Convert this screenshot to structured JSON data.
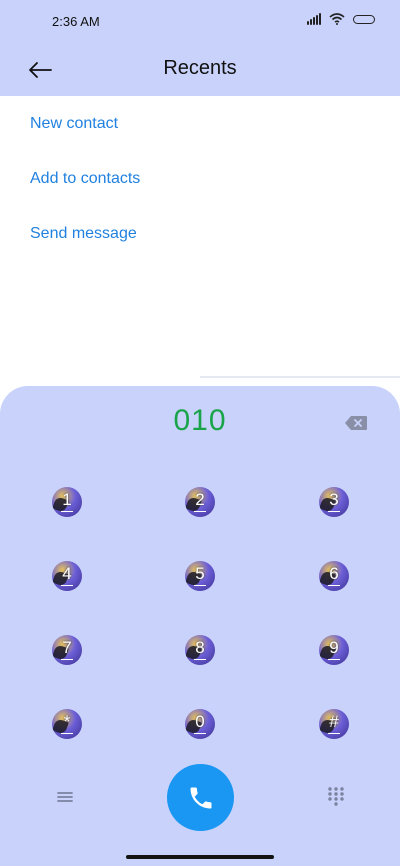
{
  "status": {
    "time": "2:36 AM"
  },
  "header": {
    "title": "Recents",
    "back_icon": "arrow-left-icon"
  },
  "actions": [
    {
      "label": "New contact"
    },
    {
      "label": "Add to contacts"
    },
    {
      "label": "Send message"
    }
  ],
  "dialer": {
    "number": "010",
    "keys": [
      {
        "digit": "1"
      },
      {
        "digit": "2"
      },
      {
        "digit": "3"
      },
      {
        "digit": "4"
      },
      {
        "digit": "5"
      },
      {
        "digit": "6"
      },
      {
        "digit": "7"
      },
      {
        "digit": "8"
      },
      {
        "digit": "9"
      },
      {
        "digit": "*"
      },
      {
        "digit": "0"
      },
      {
        "digit": "#"
      }
    ],
    "icons": {
      "backspace": "backspace-icon",
      "menu": "menu-icon",
      "call": "phone-icon",
      "keypad": "dialpad-icon"
    }
  },
  "colors": {
    "header_bg": "#c8d2fb",
    "action_text": "#2181e0",
    "dial_number": "#1aa44a",
    "call_button": "#1a97f2"
  }
}
